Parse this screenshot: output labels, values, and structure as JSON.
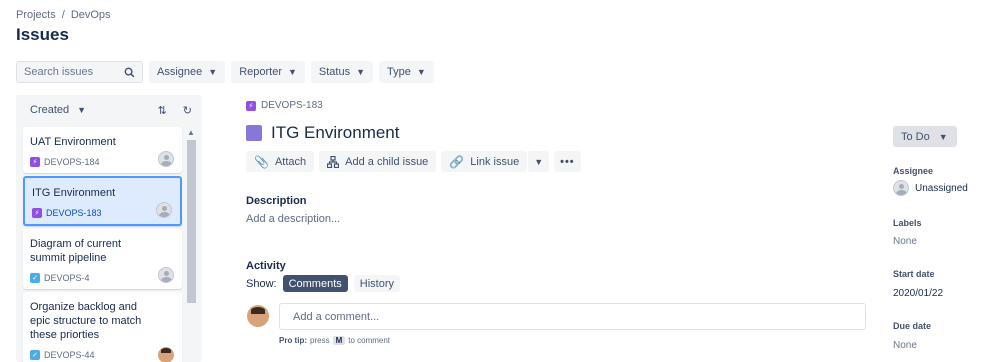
{
  "breadcrumb": {
    "items": [
      "Projects",
      "/",
      "DevOps"
    ]
  },
  "page_title": "Issues",
  "filters": {
    "search_placeholder": "Search issues",
    "buttons": [
      "Assignee",
      "Reporter",
      "Status",
      "Type"
    ]
  },
  "left_panel": {
    "sort_label": "Created",
    "issues": [
      {
        "title": "UAT Environment",
        "key": "DEVOPS-184",
        "type": "epic",
        "avatar": "placeholder"
      },
      {
        "title": "ITG Environment",
        "key": "DEVOPS-183",
        "type": "epic",
        "avatar": "placeholder",
        "selected": true
      },
      {
        "title": "Diagram of current summit pipeline",
        "key": "DEVOPS-4",
        "type": "task",
        "avatar": "placeholder"
      },
      {
        "title": "Organize backlog and epic structure to match these priorties",
        "key": "DEVOPS-44",
        "type": "task",
        "avatar": "photo"
      }
    ]
  },
  "issue": {
    "key": "DEVOPS-183",
    "title": "ITG Environment",
    "actions": {
      "attach": "Attach",
      "add_child": "Add a child issue",
      "link": "Link issue"
    },
    "description_label": "Description",
    "description_placeholder": "Add a description...",
    "activity_label": "Activity",
    "show_label": "Show:",
    "tabs": {
      "comments": "Comments",
      "history": "History"
    },
    "comment_placeholder": "Add a comment...",
    "pro_tip_label": "Pro tip:",
    "pro_tip_press": "press",
    "pro_tip_key": "M",
    "pro_tip_suffix": "to comment"
  },
  "sidebar": {
    "status": "To Do",
    "assignee_label": "Assignee",
    "assignee_value": "Unassigned",
    "labels_label": "Labels",
    "labels_value": "None",
    "start_date_label": "Start date",
    "start_date_value": "2020/01/22",
    "due_date_label": "Due date",
    "due_date_value": "None"
  },
  "colors": {
    "accent": "#0052cc",
    "selected_border": "#4c9aff",
    "epic": "#904ee2",
    "task": "#4bade8",
    "heading_square": "#8777d9"
  }
}
